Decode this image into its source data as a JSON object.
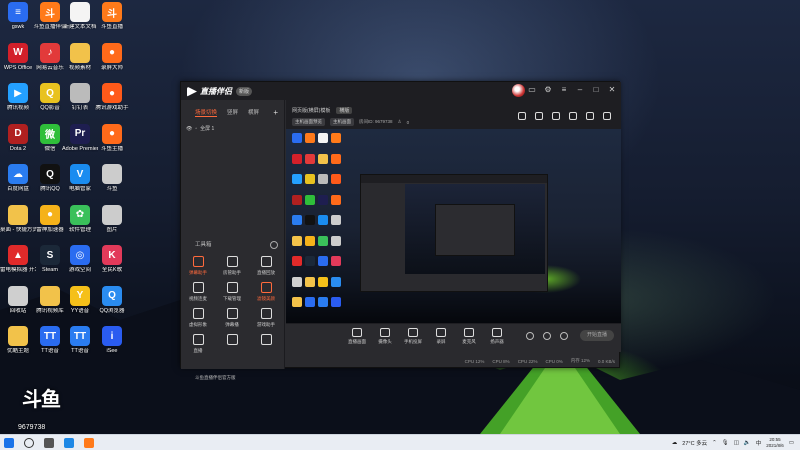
{
  "desktop": {
    "icons": [
      {
        "label": "gswk",
        "color": "#2a6cf0",
        "glyph": "≡"
      },
      {
        "label": "斗鱼直播伴侣",
        "color": "#ff7a1a",
        "glyph": "斗"
      },
      {
        "label": "新建文本文档",
        "color": "#f4f4f4",
        "glyph": ""
      },
      {
        "label": "斗鱼直播",
        "color": "#ff7a1a",
        "glyph": "斗"
      },
      {
        "label": "WPS Office",
        "color": "#d3202a",
        "glyph": "W"
      },
      {
        "label": "网易云音乐",
        "color": "#e23a3a",
        "glyph": "♪"
      },
      {
        "label": "视频素材",
        "color": "#f2c24a",
        "glyph": ""
      },
      {
        "label": "录屏大师",
        "color": "#ff6a1a",
        "glyph": "●"
      },
      {
        "label": "腾讯视频",
        "color": "#24a0ff",
        "glyph": "▶"
      },
      {
        "label": "QQ影音",
        "color": "#e8c220",
        "glyph": "Q"
      },
      {
        "label": "钉钉表",
        "color": "#bbbbbb",
        "glyph": ""
      },
      {
        "label": "腾讯游戏助手",
        "color": "#ff5a1a",
        "glyph": "●"
      },
      {
        "label": "Dota 2",
        "color": "#b02020",
        "glyph": "D"
      },
      {
        "label": "微信",
        "color": "#2fbf3a",
        "glyph": "微"
      },
      {
        "label": "Adobe Premiere",
        "color": "#1e1e50",
        "glyph": "Pr"
      },
      {
        "label": "斗鱼主播",
        "color": "#ff6a1a",
        "glyph": "●"
      },
      {
        "label": "百度网盘",
        "color": "#2a7cf0",
        "glyph": "☁"
      },
      {
        "label": "腾讯QQ",
        "color": "#111111",
        "glyph": "Q"
      },
      {
        "label": "电脑管家",
        "color": "#1a8cf0",
        "glyph": "V"
      },
      {
        "label": "斗鱼",
        "color": "#cccccc",
        "glyph": ""
      },
      {
        "label": "桌面 - 快捷方式",
        "color": "#f2c24a",
        "glyph": ""
      },
      {
        "label": "雷神加速器",
        "color": "#f5b21a",
        "glyph": "●"
      },
      {
        "label": "软件管理",
        "color": "#3ac05a",
        "glyph": "✿"
      },
      {
        "label": "图片",
        "color": "#cccccc",
        "glyph": ""
      },
      {
        "label": "雷电模拟器 开发平台",
        "color": "#e02a2a",
        "glyph": "▲"
      },
      {
        "label": "Steam",
        "color": "#1b2838",
        "glyph": "S"
      },
      {
        "label": "游戏空间",
        "color": "#2a6cf0",
        "glyph": "◎"
      },
      {
        "label": "全民K歌",
        "color": "#e23a5a",
        "glyph": "K"
      },
      {
        "label": "回收站",
        "color": "#cfcfcf",
        "glyph": ""
      },
      {
        "label": "腾讯视频库",
        "color": "#f2c24a",
        "glyph": ""
      },
      {
        "label": "YY语音",
        "color": "#f5c01a",
        "glyph": "Y"
      },
      {
        "label": "QQ浏览器",
        "color": "#2a8cf0",
        "glyph": "Q"
      },
      {
        "label": "优酷主题",
        "color": "#f2c24a",
        "glyph": ""
      },
      {
        "label": "TT语音",
        "color": "#2a6cf0",
        "glyph": "TT"
      },
      {
        "label": "TT语音",
        "color": "#2a7cf0",
        "glyph": "TT"
      },
      {
        "label": "iSee",
        "color": "#2a5cf0",
        "glyph": "i"
      }
    ]
  },
  "app": {
    "title": "直播伴侣",
    "badge": "新版",
    "scene_tabs": [
      "场景切换",
      "竖屏",
      "横屏"
    ],
    "scene_item": "全屏 1",
    "toolbox_title": "工具箱",
    "tools": [
      {
        "label": "弹幕助手",
        "active": true
      },
      {
        "label": "房管助手",
        "active": false
      },
      {
        "label": "直播回放",
        "active": false
      },
      {
        "label": "视频连麦",
        "active": false
      },
      {
        "label": "下载管理",
        "active": false
      },
      {
        "label": "滤镜美颜",
        "active": true
      },
      {
        "label": "虚拟形象",
        "active": false
      },
      {
        "label": "弹幕播",
        "active": false
      },
      {
        "label": "游戏助手",
        "active": false
      },
      {
        "label": "直播",
        "active": false
      },
      {
        "label": "",
        "active": false
      },
      {
        "label": "",
        "active": false
      }
    ],
    "status_left": "斗鱼直播伴侣官方版",
    "preview_tabs": [
      "网页版(横屏)模板",
      "横版"
    ],
    "room_info": [
      "主机画面预览",
      "主机画面"
    ],
    "room_id": "房间ID: 9679738",
    "room_count": "0",
    "watermark": "斗鱼",
    "controls": [
      "直播画面",
      "摄像头",
      "手机投屏",
      "录屏",
      "麦克风",
      "扬声器"
    ],
    "live_button": "开始直播",
    "status_right": [
      "CPU 12%",
      "CPU 8%",
      "CPU 22%",
      "CPU 0%",
      "内存 12%",
      "0.0 KB/s"
    ]
  },
  "overlay": {
    "big": "斗鱼",
    "id": "9679738"
  },
  "taskbar": {
    "weather": "27°C 多云",
    "time": "20:55",
    "date": "2021/8/6"
  }
}
